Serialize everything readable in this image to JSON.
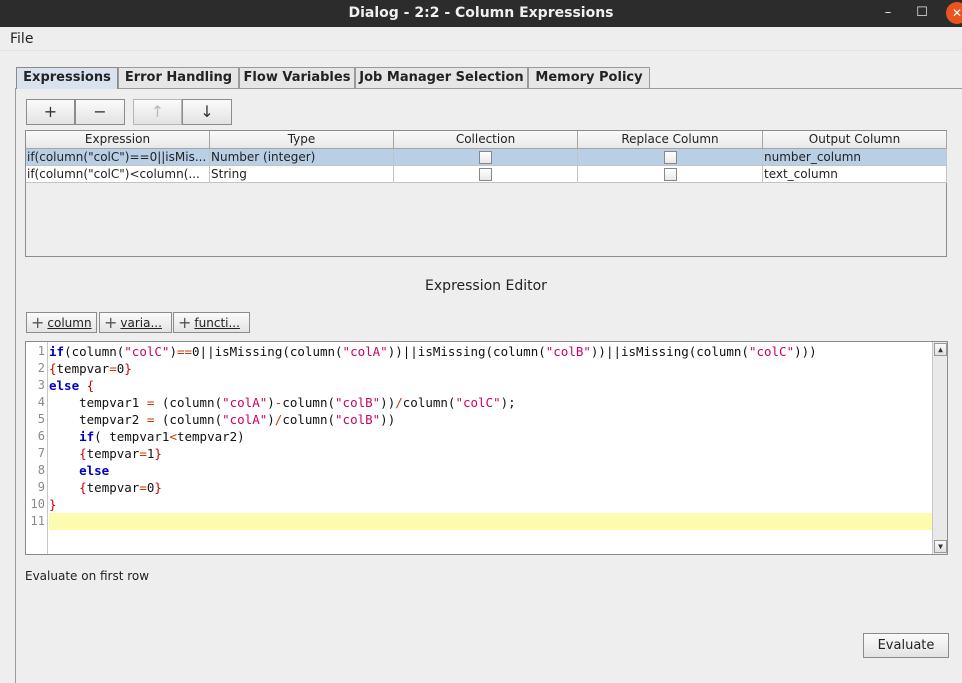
{
  "window": {
    "title": "Dialog - 2:2 - Column Expressions",
    "controls": {
      "minimize": "–",
      "maximize": "☐",
      "close": "✕"
    }
  },
  "menubar": {
    "file": "File"
  },
  "tabs": [
    {
      "label": "Expressions",
      "active": true
    },
    {
      "label": "Error Handling"
    },
    {
      "label": "Flow Variables"
    },
    {
      "label": "Job Manager Selection"
    },
    {
      "label": "Memory Policy"
    }
  ],
  "toolbar": {
    "add": "+",
    "remove": "−",
    "up": "↑",
    "down": "↓"
  },
  "table": {
    "headers": [
      "Expression",
      "Type",
      "Collection",
      "Replace Column",
      "Output Column"
    ],
    "rows": [
      {
        "expression": "if(column(\"colC\")==0||isMis...",
        "type": "Number (integer)",
        "collection": false,
        "replace": false,
        "output": "number_column",
        "selected": true
      },
      {
        "expression": "if(column(\"colC\")<column(...",
        "type": "String",
        "collection": false,
        "replace": false,
        "output": "text_column",
        "selected": false
      }
    ]
  },
  "editor": {
    "title": "Expression Editor",
    "buttons": {
      "column": "column",
      "variable": "varia...",
      "function": "functi..."
    },
    "line_numbers": [
      "1",
      "2",
      "3",
      "4",
      "5",
      "6",
      "7",
      "8",
      "9",
      "10",
      "11"
    ],
    "current_line": 11
  },
  "status": {
    "hint": "Evaluate on first row"
  },
  "evaluate_label": "Evaluate"
}
